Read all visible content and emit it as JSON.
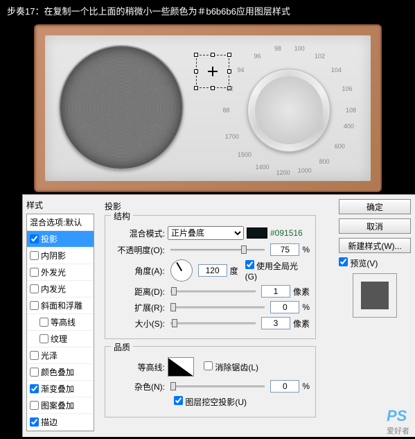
{
  "caption": "步奏17：在复制一个比上面的稍微小一些颜色为＃b6b6b6应用图层样式",
  "dial_labels": [
    "88",
    "92",
    "94",
    "96",
    "98",
    "100",
    "102",
    "104",
    "106",
    "108",
    "400",
    "600",
    "800",
    "1000",
    "1200",
    "1400",
    "1500",
    "1700"
  ],
  "dialog": {
    "styles_header": "样式",
    "blend_opts": "混合选项:默认",
    "rows": [
      {
        "label": "投影",
        "checked": true,
        "selected": true,
        "indent": false
      },
      {
        "label": "内阴影",
        "checked": false,
        "selected": false,
        "indent": false
      },
      {
        "label": "外发光",
        "checked": false,
        "selected": false,
        "indent": false
      },
      {
        "label": "内发光",
        "checked": false,
        "selected": false,
        "indent": false
      },
      {
        "label": "斜面和浮雕",
        "checked": false,
        "selected": false,
        "indent": false
      },
      {
        "label": "等高线",
        "checked": false,
        "selected": false,
        "indent": true
      },
      {
        "label": "纹理",
        "checked": false,
        "selected": false,
        "indent": true
      },
      {
        "label": "光泽",
        "checked": false,
        "selected": false,
        "indent": false
      },
      {
        "label": "颜色叠加",
        "checked": false,
        "selected": false,
        "indent": false
      },
      {
        "label": "渐变叠加",
        "checked": true,
        "selected": false,
        "indent": false
      },
      {
        "label": "图案叠加",
        "checked": false,
        "selected": false,
        "indent": false
      },
      {
        "label": "描边",
        "checked": true,
        "selected": false,
        "indent": false
      }
    ],
    "panel_title": "投影",
    "group_structure": "结构",
    "blend_mode_label": "混合模式:",
    "blend_mode_value": "正片叠底",
    "swatch_color": "#091516",
    "hex_text": "#091516",
    "opacity_label": "不透明度(O):",
    "opacity_value": "75",
    "percent": "%",
    "angle_label": "角度(A):",
    "angle_value": "120",
    "degree": "度",
    "global_light": "使用全局光(G)",
    "distance_label": "距离(D):",
    "distance_value": "1",
    "px": "像素",
    "spread_label": "扩展(R):",
    "spread_value": "0",
    "size_label": "大小(S):",
    "size_value": "3",
    "group_quality": "品质",
    "contour_label": "等高线:",
    "antialias": "消除锯齿(L)",
    "noise_label": "杂色(N):",
    "noise_value": "0",
    "knockout": "图层挖空投影(U)",
    "buttons": {
      "ok": "确定",
      "cancel": "取消",
      "new_style": "新建样式(W)...",
      "preview": "预览(V)"
    }
  },
  "watermark": {
    "logo": "PS",
    "sub": "爱好者"
  }
}
